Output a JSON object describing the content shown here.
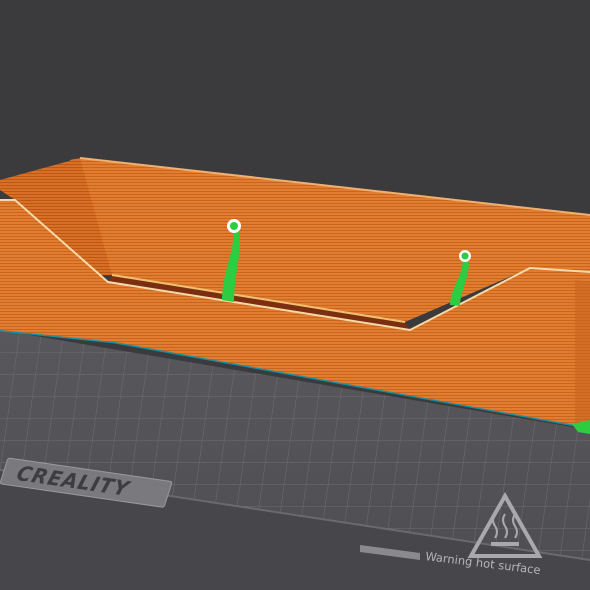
{
  "viewport": {
    "background_color": "#3b3b3e",
    "bed_color": "#5b5b5f",
    "grid_color": "#6f6f73",
    "model_color": "#e07a2e",
    "support_color": "#2ecc40",
    "brim_color": "#1c8ea0"
  },
  "bed": {
    "brand_label": "CREALITY",
    "warning_label": "Warning hot surface",
    "warning_icon": "hot-surface-icon"
  },
  "model": {
    "name_icon": "sliced-tray-model",
    "supports": [
      "support-left",
      "support-right"
    ]
  }
}
